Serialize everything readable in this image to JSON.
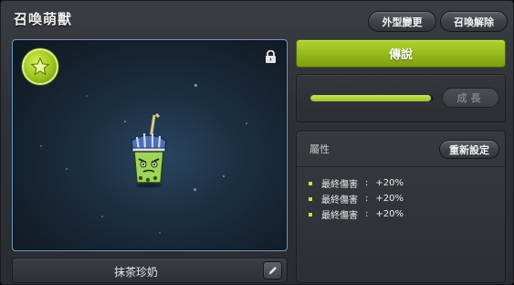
{
  "window": {
    "title": "召喚萌獸",
    "appearance_change_label": "外型變更",
    "unsummon_label": "召喚解除"
  },
  "pet": {
    "name": "抹茶珍奶",
    "rarity": "傳說",
    "grow_label": "成長",
    "grow_progress": 0.98,
    "locked": true,
    "badge_icon": "star-icon"
  },
  "attributes": {
    "title": "屬性",
    "reset_label": "重新設定",
    "items": [
      {
        "name": "最終傷害",
        "sep": ":",
        "value": "+20%"
      },
      {
        "name": "最終傷害",
        "sep": ":",
        "value": "+20%"
      },
      {
        "name": "最終傷害",
        "sep": ":",
        "value": "+20%"
      }
    ]
  },
  "colors": {
    "accent_green": "#9cc12b",
    "panel_dark": "#2c2f33",
    "pet_frame": "#6d9ec8"
  }
}
